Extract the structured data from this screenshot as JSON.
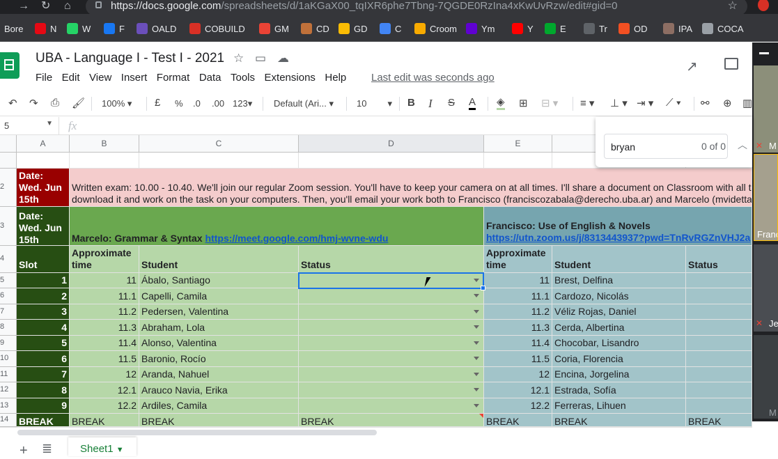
{
  "browser": {
    "url_prefix": "https://docs.google.com",
    "url_rest": "/spreadsheets/d/1aKGaX00_tqIXR6phe7Tbng-7QGDE0RzIna4xKwUvRzw/edit#gid=0"
  },
  "bookmarks": [
    {
      "label": "Bore",
      "color": "#8ab4f8"
    },
    {
      "label": "N",
      "color": "#e50914"
    },
    {
      "label": "W",
      "color": "#25d366"
    },
    {
      "label": "F",
      "color": "#1877f2"
    },
    {
      "label": "OALD",
      "color": "#6b4fbb"
    },
    {
      "label": "COBUILD",
      "color": "#d93025"
    },
    {
      "label": "GM",
      "color": "#ea4335"
    },
    {
      "label": "CD",
      "color": "#c0713a"
    },
    {
      "label": "GD",
      "color": "#fbbc04"
    },
    {
      "label": "C",
      "color": "#4285f4"
    },
    {
      "label": "Croom",
      "color": "#f9ab00"
    },
    {
      "label": "Ym",
      "color": "#5f01d1"
    },
    {
      "label": "Y",
      "color": "#ff0000"
    },
    {
      "label": "E",
      "color": "#00a82d"
    },
    {
      "label": "Tr",
      "color": "#5f6368"
    },
    {
      "label": "OD",
      "color": "#f25022"
    },
    {
      "label": "IPA",
      "color": "#8d6e63"
    },
    {
      "label": "COCA",
      "color": "#9aa0a6"
    }
  ],
  "doc": {
    "title": "UBA - Language I - Test I - 2021",
    "last_edit": "Last edit was seconds ago",
    "menu": [
      "File",
      "Edit",
      "View",
      "Insert",
      "Format",
      "Data",
      "Tools",
      "Extensions",
      "Help"
    ]
  },
  "toolbar": {
    "zoom": "100%",
    "currency": "£",
    "percent": "%",
    "dec_less": ".0",
    "dec_more": ".00",
    "format": "123",
    "font": "Default (Ari...",
    "font_size": "10"
  },
  "formula": {
    "name_box": "5",
    "fx": "fx"
  },
  "find": {
    "query": "bryan",
    "count": "0 of 0"
  },
  "columns": [
    "A",
    "B",
    "C",
    "D",
    "E"
  ],
  "rows": {
    "r2": {
      "num": "2",
      "date": "Date: Wed. Jun 15th",
      "text1": "Written exam: 10.00 - 10.40. We'll join our regular Zoom session. You'll have to keep your camera on at all times. I'll share a document on Classroom with all t",
      "text2": "download it and work on the task on your computers. Then, you'll email your work both to Francisco (franciscozabala@derecho.uba.ar) and Marcelo (mvidetta"
    },
    "r3": {
      "num": "3",
      "date": "Date: Wed. Jun 15th",
      "marcelo_label": "Marcelo: Grammar & Syntax",
      "marcelo_link": "https://meet.google.com/hmj-wvne-wdu",
      "francisco_label": "Francisco: Use of English & Novels",
      "francisco_link": "https://utn.zoom.us/j/8313443937?pwd=TnRvRGZnVHJ2a"
    },
    "r4": {
      "num": "4",
      "slot": "Slot",
      "approx": "Approximate time",
      "student": "Student",
      "status": "Status"
    },
    "data": [
      {
        "num": "5",
        "slot": "1",
        "t1": "11",
        "s1": "Ábalo, Santiago",
        "t2": "11",
        "s2": "Brest, Delfina"
      },
      {
        "num": "6",
        "slot": "2",
        "t1": "11.1",
        "s1": "Capelli, Camila",
        "t2": "11.1",
        "s2": "Cardozo, Nicolás"
      },
      {
        "num": "7",
        "slot": "3",
        "t1": "11.2",
        "s1": "Pedersen, Valentina",
        "t2": "11.2",
        "s2": "Véliz Rojas, Daniel"
      },
      {
        "num": "8",
        "slot": "4",
        "t1": "11.3",
        "s1": "Abraham, Lola",
        "t2": "11.3",
        "s2": "Cerda, Albertina"
      },
      {
        "num": "9",
        "slot": "5",
        "t1": "11.4",
        "s1": "Alonso, Valentina",
        "t2": "11.4",
        "s2": "Chocobar, Lisandro"
      },
      {
        "num": "10",
        "slot": "6",
        "t1": "11.5",
        "s1": "Baronio, Rocío",
        "t2": "11.5",
        "s2": "Coria, Florencia"
      },
      {
        "num": "11",
        "slot": "7",
        "t1": "12",
        "s1": "Aranda, Nahuel",
        "t2": "12",
        "s2": "Encina, Jorgelina"
      },
      {
        "num": "12",
        "slot": "8",
        "t1": "12.1",
        "s1": "Arauco Navia, Erika",
        "t2": "12.1",
        "s2": "Estrada, Sofía"
      },
      {
        "num": "13",
        "slot": "9",
        "t1": "12.2",
        "s1": "Ardiles, Camila",
        "t2": "12.2",
        "s2": "Ferreras, Lihuen"
      }
    ],
    "r14": {
      "num": "14",
      "label": "BREAK"
    }
  },
  "sheet_tab": "Sheet1",
  "video": {
    "p1": "M",
    "p2": "Franc",
    "p3": "Je",
    "p4": "M"
  }
}
